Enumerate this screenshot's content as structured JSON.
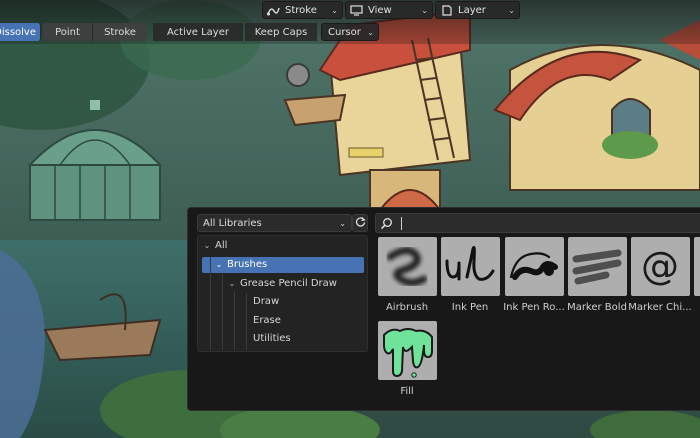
{
  "toolbar": {
    "stroke_menu": "Stroke",
    "view_menu": "View",
    "layer_menu": "Layer",
    "mode_dissolve": "Dissolve",
    "mode_point": "Point",
    "mode_stroke": "Stroke",
    "active_layer": "Active Layer",
    "keep_caps": "Keep Caps",
    "cursor_menu": "Cursor"
  },
  "asset_browser": {
    "library": "All Libraries",
    "tree": [
      {
        "label": "All"
      },
      {
        "label": "Brushes",
        "selected": true
      },
      {
        "label": "Grease Pencil Draw"
      },
      {
        "label": "Draw"
      },
      {
        "label": "Erase"
      },
      {
        "label": "Utilities"
      }
    ],
    "search_value": "",
    "assets": [
      {
        "label": "Airbrush",
        "icon": "airbrush-stroke-icon"
      },
      {
        "label": "Ink Pen",
        "icon": "ink-pen-stroke-icon"
      },
      {
        "label": "Ink Pen Ro...",
        "icon": "ink-pen-rough-stroke-icon"
      },
      {
        "label": "Marker Bold",
        "icon": "marker-bold-stroke-icon"
      },
      {
        "label": "Marker Chi...",
        "icon": "marker-chisel-stroke-icon"
      },
      {
        "label": "Fill",
        "icon": "fill-drip-icon"
      }
    ]
  },
  "colors": {
    "accent": "#4772b3",
    "panel_bg": "#181818",
    "fill_green": "#6fe39a"
  }
}
